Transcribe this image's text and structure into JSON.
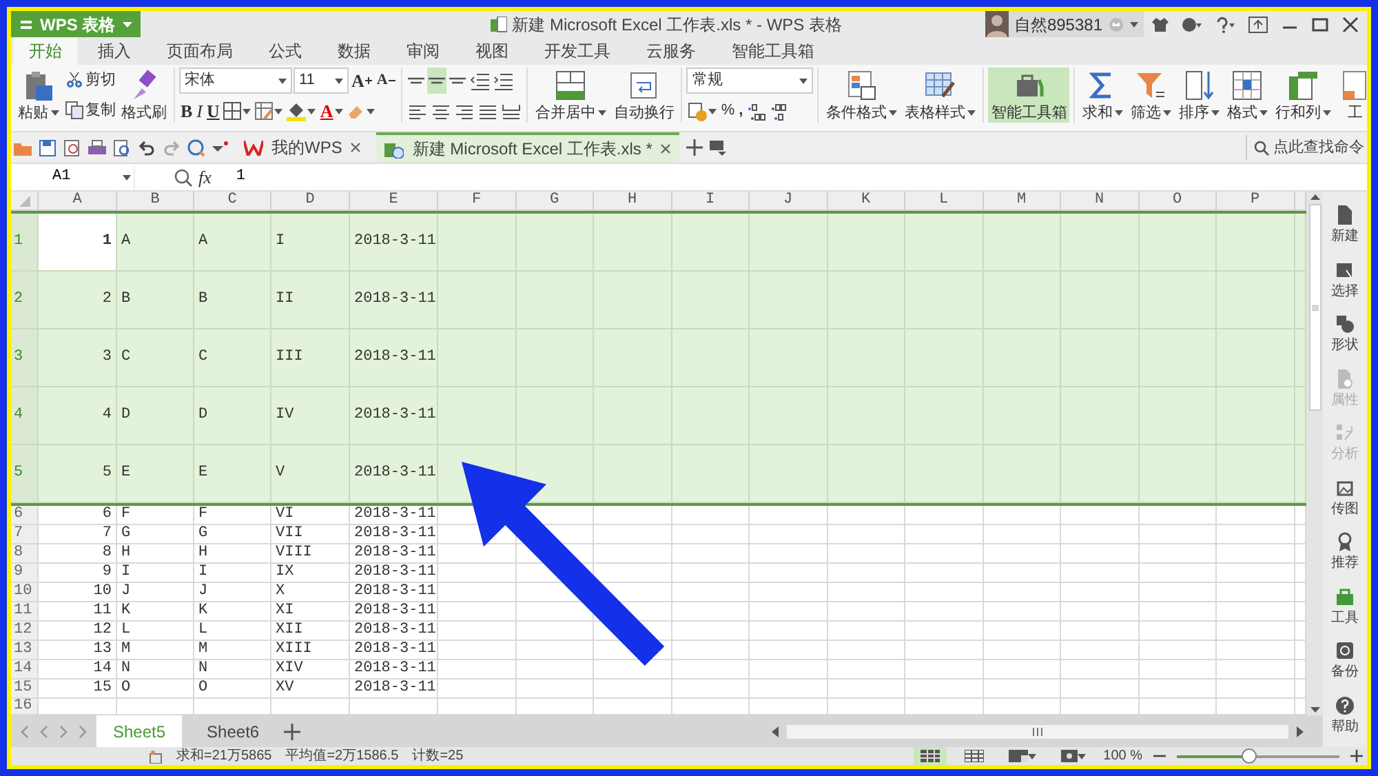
{
  "title_bar": {
    "app_button": "WPS 表格",
    "title": "新建 Microsoft Excel 工作表.xls * - WPS 表格",
    "user": "自然895381"
  },
  "menu_tabs": [
    {
      "label": "开始",
      "selected": true
    },
    {
      "label": "插入",
      "selected": false
    },
    {
      "label": "页面布局",
      "selected": false
    },
    {
      "label": "公式",
      "selected": false
    },
    {
      "label": "数据",
      "selected": false
    },
    {
      "label": "审阅",
      "selected": false
    },
    {
      "label": "视图",
      "selected": false
    },
    {
      "label": "开发工具",
      "selected": false
    },
    {
      "label": "云服务",
      "selected": false
    },
    {
      "label": "智能工具箱",
      "selected": false
    }
  ],
  "ribbon": {
    "groups": [
      {
        "kind": "clipboard",
        "paste": "粘贴",
        "cut": "剪切",
        "copy": "复制",
        "format_painter": "格式刷"
      },
      {
        "kind": "font",
        "font_name": "宋体",
        "font_size": "11",
        "grow": "A",
        "shrink": "A",
        "bold": "B",
        "italic": "I",
        "underline": "U",
        "font_color": "A"
      },
      {
        "kind": "alignment",
        "vertical": [
          {
            "selected": false
          },
          {
            "selected": true
          },
          {
            "selected": false
          }
        ]
      },
      {
        "kind": "buttons",
        "buttons": [
          {
            "kind": "merge",
            "label": "合并居中",
            "dropdown": true,
            "highlighted": false
          },
          {
            "kind": "wrap",
            "label": "自动换行",
            "dropdown": false,
            "highlighted": false
          }
        ]
      },
      {
        "kind": "number",
        "format": "常规",
        "percent": "%",
        "comma": ","
      },
      {
        "kind": "buttons",
        "buttons": [
          {
            "kind": "conditional",
            "label": "条件格式",
            "dropdown": true,
            "highlighted": false
          },
          {
            "kind": "table_style",
            "label": "表格样式",
            "dropdown": true,
            "highlighted": false
          }
        ]
      },
      {
        "kind": "buttons",
        "buttons": [
          {
            "kind": "toolbox",
            "label": "智能工具箱",
            "dropdown": false,
            "highlighted": true
          }
        ]
      },
      {
        "kind": "buttons",
        "buttons": [
          {
            "kind": "sum",
            "label": "求和",
            "dropdown": true,
            "highlighted": false
          },
          {
            "kind": "filter",
            "label": "筛选",
            "dropdown": true,
            "highlighted": false
          },
          {
            "kind": "sort",
            "label": "排序",
            "dropdown": true,
            "highlighted": false
          },
          {
            "kind": "format",
            "label": "格式",
            "dropdown": true,
            "highlighted": false
          },
          {
            "kind": "rows_cols",
            "label": "行和列",
            "dropdown": true,
            "highlighted": false
          },
          {
            "kind": "sheet",
            "label": "工",
            "dropdown": false,
            "highlighted": false
          }
        ]
      }
    ]
  },
  "doc_tabs": [
    {
      "kind": "home",
      "label": "我的WPS",
      "selected": false
    },
    {
      "kind": "file",
      "label": "新建 Microsoft Excel 工作表.xls *",
      "selected": true
    }
  ],
  "command_search": {
    "placeholder": "点此查找命令"
  },
  "formula_bar": {
    "name_box": "A1",
    "fx_label": "fx",
    "value": "1"
  },
  "sheet": {
    "columns": [
      "A",
      "B",
      "C",
      "D",
      "E",
      "F",
      "G",
      "H",
      "I",
      "J",
      "K",
      "L",
      "M",
      "N",
      "O",
      "P"
    ],
    "rows": [
      {
        "header": "1",
        "selected": true,
        "cursor_cell": true,
        "cells": [
          "1",
          "A",
          "A",
          "I",
          "2018-3-11"
        ]
      },
      {
        "header": "2",
        "selected": true,
        "cursor_cell": false,
        "cells": [
          "2",
          "B",
          "B",
          "II",
          "2018-3-11"
        ]
      },
      {
        "header": "3",
        "selected": true,
        "cursor_cell": false,
        "cells": [
          "3",
          "C",
          "C",
          "III",
          "2018-3-11"
        ]
      },
      {
        "header": "4",
        "selected": true,
        "cursor_cell": false,
        "cells": [
          "4",
          "D",
          "D",
          "IV",
          "2018-3-11"
        ]
      },
      {
        "header": "5",
        "selected": true,
        "cursor_cell": false,
        "cells": [
          "5",
          "E",
          "E",
          "V",
          "2018-3-11"
        ]
      },
      {
        "header": "6",
        "selected": false,
        "cursor_cell": false,
        "cells": [
          "6",
          "F",
          "F",
          "VI",
          "2018-3-11"
        ]
      },
      {
        "header": "7",
        "selected": false,
        "cursor_cell": false,
        "cells": [
          "7",
          "G",
          "G",
          "VII",
          "2018-3-11"
        ]
      },
      {
        "header": "8",
        "selected": false,
        "cursor_cell": false,
        "cells": [
          "8",
          "H",
          "H",
          "VIII",
          "2018-3-11"
        ]
      },
      {
        "header": "9",
        "selected": false,
        "cursor_cell": false,
        "cells": [
          "9",
          "I",
          "I",
          "IX",
          "2018-3-11"
        ]
      },
      {
        "header": "10",
        "selected": false,
        "cursor_cell": false,
        "cells": [
          "10",
          "J",
          "J",
          "X",
          "2018-3-11"
        ]
      },
      {
        "header": "11",
        "selected": false,
        "cursor_cell": false,
        "cells": [
          "11",
          "K",
          "K",
          "XI",
          "2018-3-11"
        ]
      },
      {
        "header": "12",
        "selected": false,
        "cursor_cell": false,
        "cells": [
          "12",
          "L",
          "L",
          "XII",
          "2018-3-11"
        ]
      },
      {
        "header": "13",
        "selected": false,
        "cursor_cell": false,
        "cells": [
          "13",
          "M",
          "M",
          "XIII",
          "2018-3-11"
        ]
      },
      {
        "header": "14",
        "selected": false,
        "cursor_cell": false,
        "cells": [
          "14",
          "N",
          "N",
          "XIV",
          "2018-3-11"
        ]
      },
      {
        "header": "15",
        "selected": false,
        "cursor_cell": false,
        "cells": [
          "15",
          "O",
          "O",
          "XV",
          "2018-3-11"
        ]
      },
      {
        "header": "16",
        "selected": false,
        "cursor_cell": false
      }
    ]
  },
  "sheet_tabs": [
    {
      "label": "Sheet5",
      "selected": true
    },
    {
      "label": "Sheet6",
      "selected": false
    }
  ],
  "side_panel": [
    {
      "kind": "new",
      "label": "新建",
      "disabled": false
    },
    {
      "kind": "select",
      "label": "选择",
      "disabled": false
    },
    {
      "kind": "shape",
      "label": "形状",
      "disabled": false
    },
    {
      "kind": "properties",
      "label": "属性",
      "disabled": true
    },
    {
      "kind": "analysis",
      "label": "分析",
      "disabled": true
    },
    {
      "kind": "image",
      "label": "传图",
      "disabled": false
    },
    {
      "kind": "recommend",
      "label": "推荐",
      "disabled": false
    },
    {
      "kind": "tools",
      "label": "工具",
      "disabled": false
    },
    {
      "kind": "backup",
      "label": "备份",
      "disabled": false
    },
    {
      "kind": "help",
      "label": "帮助",
      "disabled": false
    }
  ],
  "status_bar": {
    "stats": [
      "求和=21万5865",
      "平均值=2万1586.5",
      "计数=25"
    ],
    "zoom": "100 %",
    "zoom_slider": {
      "level": 0.44
    }
  },
  "overlay": {
    "kind": "arrow"
  }
}
